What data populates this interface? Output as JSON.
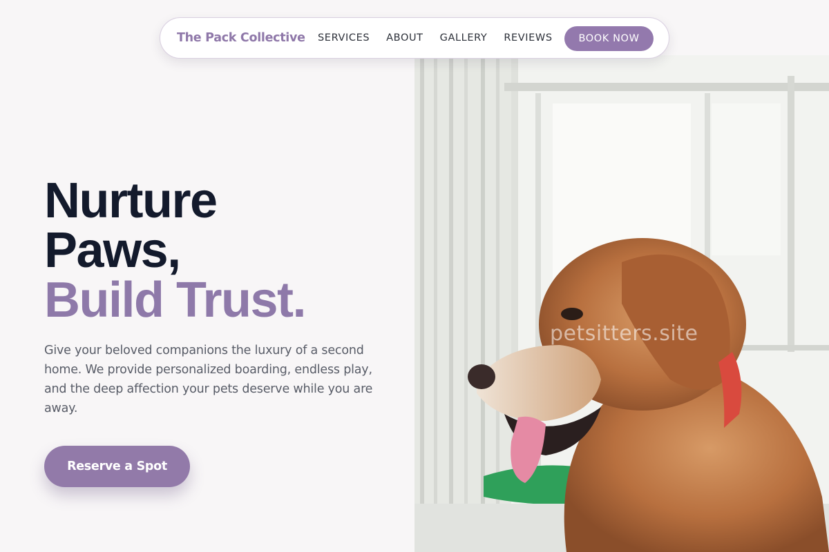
{
  "nav": {
    "brand": "The Pack Collective",
    "links": [
      "SERVICES",
      "ABOUT",
      "GALLERY",
      "REVIEWS"
    ],
    "cta": "BOOK NOW"
  },
  "hero": {
    "headline_line1": "Nurture",
    "headline_line2": "Paws,",
    "headline_line3": "Build Trust.",
    "description": "Give your beloved companions the luxury of a second home. We provide personalized boarding, endless play, and the deep affection your pets deserve while you are away.",
    "cta": "Reserve a Spot",
    "image_watermark": "petsitters.site"
  },
  "colors": {
    "accent": "#9379ad",
    "headline_dark": "#131a2c",
    "body_text": "#585c67",
    "background": "#f8f6f7"
  },
  "icons": {
    "hero_image": "golden-retriever-photo"
  }
}
